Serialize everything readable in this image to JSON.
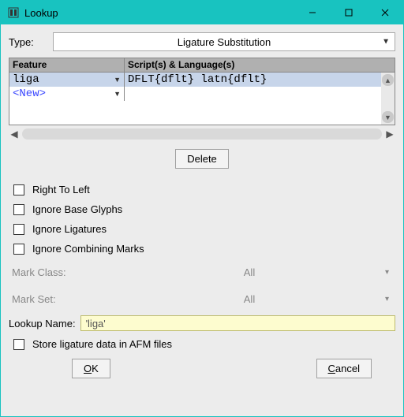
{
  "window": {
    "title": "Lookup"
  },
  "type": {
    "label": "Type:",
    "value": "Ligature Substitution"
  },
  "grid": {
    "head_feature": "Feature",
    "head_scripts": "Script(s) & Language(s)",
    "rows": [
      {
        "feature": "liga",
        "scripts": "DFLT{dflt} latn{dflt}"
      }
    ],
    "new_label": "<New>"
  },
  "delete_label": "Delete",
  "checks": {
    "rtl": "Right To Left",
    "ignore_base": "Ignore Base Glyphs",
    "ignore_liga": "Ignore Ligatures",
    "ignore_marks": "Ignore Combining Marks"
  },
  "mark_class": {
    "label": "Mark Class:",
    "value": "All"
  },
  "mark_set": {
    "label": "Mark Set:",
    "value": "All"
  },
  "lookup_name": {
    "label": "Lookup Name:",
    "value": "'liga'"
  },
  "store_afm": "Store ligature data in AFM files",
  "buttons": {
    "ok": "OK",
    "cancel": "Cancel"
  }
}
